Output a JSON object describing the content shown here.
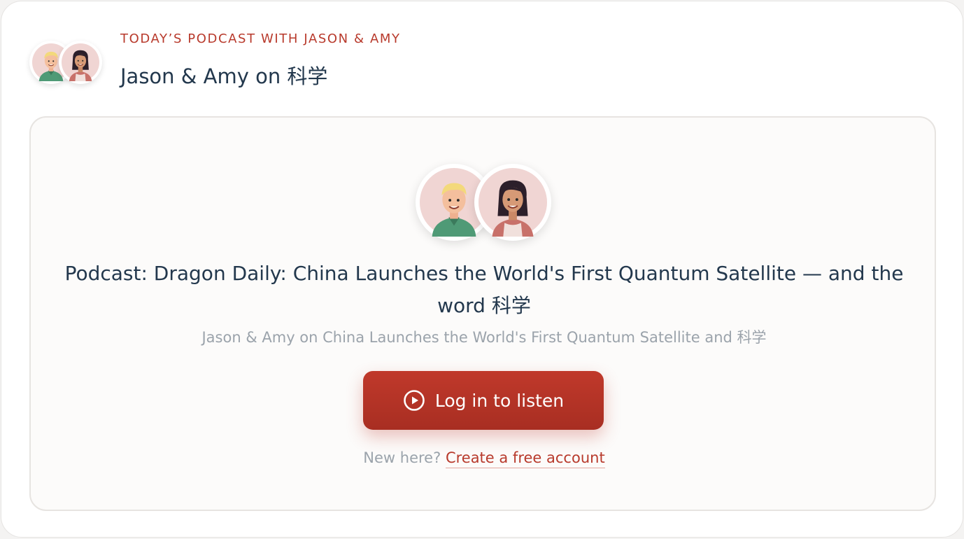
{
  "header": {
    "kicker": "TODAY’S PODCAST WITH JASON & AMY",
    "title": "Jason & Amy on 科学"
  },
  "hosts": [
    {
      "name": "Jason",
      "icon": "host-jason-avatar-icon"
    },
    {
      "name": "Amy",
      "icon": "host-amy-avatar-icon"
    }
  ],
  "episode": {
    "title": "Podcast: Dragon Daily: China Launches the World's First Quantum Satellite — and the word 科学",
    "subtitle": "Jason & Amy on China Launches the World's First Quantum Satellite and 科学"
  },
  "cta": {
    "login_label": "Log in to listen",
    "login_icon": "play-circle-icon",
    "signup_prompt": "New here?",
    "signup_link": "Create a free account"
  },
  "colors": {
    "accent": "#c0392b",
    "heading": "#23384d",
    "muted": "#9ba3ab",
    "panel_bg": "#fcfbfa"
  }
}
